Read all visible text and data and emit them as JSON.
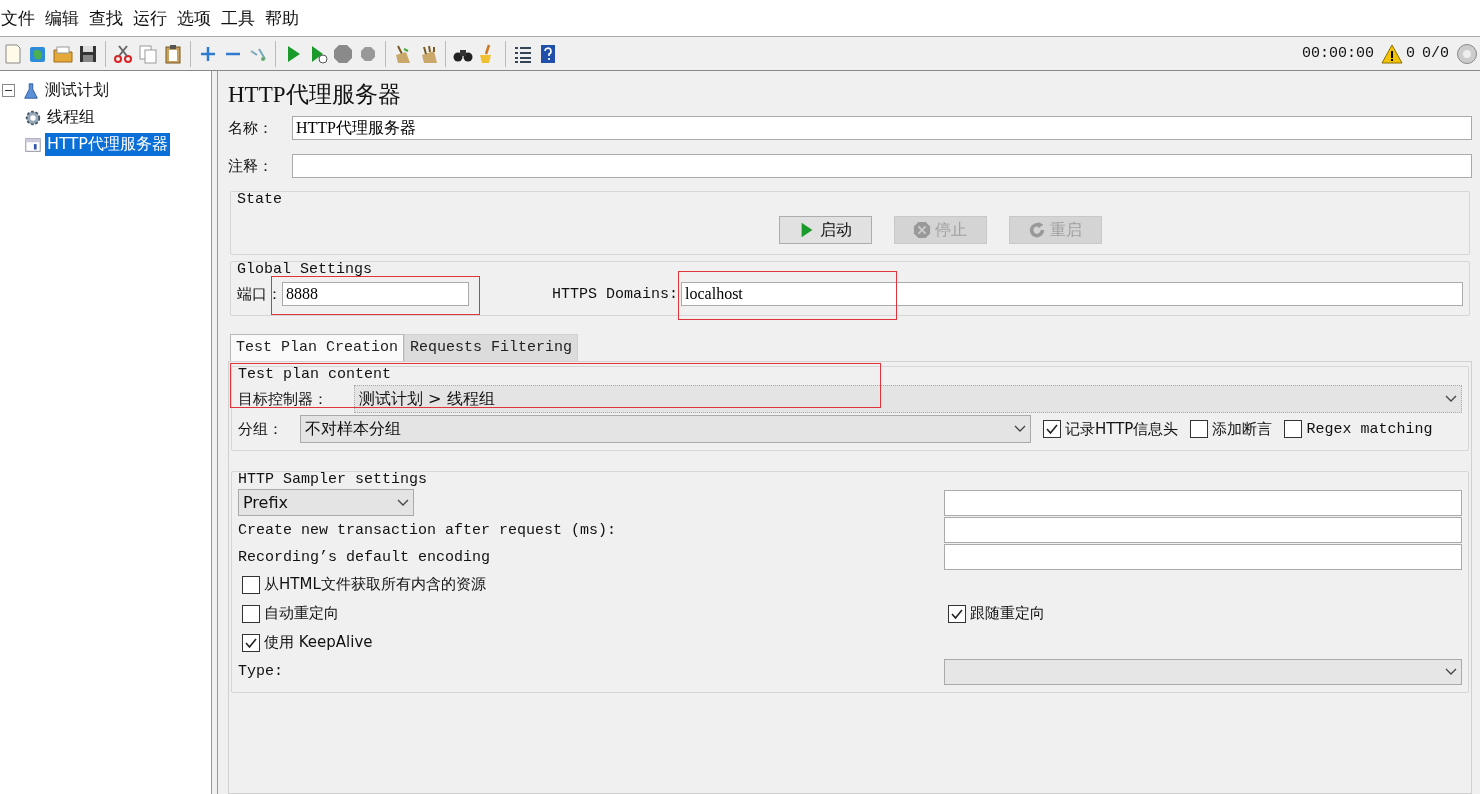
{
  "menu": [
    "文件",
    "编辑",
    "查找",
    "运行",
    "选项",
    "工具",
    "帮助"
  ],
  "status": {
    "timer": "00:00:00",
    "warnings": "0",
    "threads": "0/0"
  },
  "tree": [
    {
      "label": "测试计划",
      "expanded": true,
      "selected": false,
      "kind": "plan",
      "children": [
        {
          "label": "线程组",
          "selected": false,
          "kind": "threads"
        },
        {
          "label": "HTTP代理服务器",
          "selected": true,
          "kind": "proxy"
        }
      ]
    }
  ],
  "panel": {
    "title": "HTTP代理服务器",
    "name": {
      "label": "名称：",
      "value": "HTTP代理服务器"
    },
    "comment": {
      "label": "注释："
    },
    "state": {
      "title": "State",
      "buttons": [
        {
          "label": "启动",
          "kind": "start",
          "disabled": false
        },
        {
          "label": "停止",
          "kind": "stop",
          "disabled": true
        },
        {
          "label": "重启",
          "kind": "restart",
          "disabled": true
        }
      ]
    },
    "global_settings": {
      "title": "Global Settings",
      "port": {
        "label": "端口：",
        "value": "8888",
        "highlighted": true
      },
      "https_domains": {
        "label": "HTTPS Domains:",
        "value": "localhost",
        "highlighted": true
      }
    },
    "tabs": [
      {
        "label": "Test Plan Creation",
        "selected": true
      },
      {
        "label": "Requests Filtering",
        "selected": false
      }
    ],
    "test_plan_content": {
      "title": "Test plan content",
      "highlighted": true,
      "target_controller": {
        "label": "目标控制器：",
        "value": "测试计划 > 线程组"
      },
      "grouping": {
        "label": "分组：",
        "value": "不对样本分组"
      },
      "options": [
        {
          "label": "记录HTTP信息头",
          "checked": true
        },
        {
          "label": "添加断言",
          "checked": false
        },
        {
          "label": "Regex matching",
          "checked": false
        }
      ]
    },
    "sampler_settings": {
      "title": "HTTP Sampler settings",
      "prefix": "Prefix",
      "transaction_label": "Create new transaction after request (ms):",
      "encoding_label": "Recording’s default encoding",
      "checkbox_rows": [
        {
          "left": {
            "label": "从HTML文件获取所有内含的资源",
            "checked": false
          }
        },
        {
          "left": {
            "label": "自动重定向",
            "checked": false
          },
          "right": {
            "label": "跟随重定向",
            "checked": true
          }
        },
        {
          "left": {
            "label": "使用 KeepAlive",
            "checked": true
          }
        }
      ],
      "type_label": "Type:",
      "type_disabled": true
    }
  }
}
